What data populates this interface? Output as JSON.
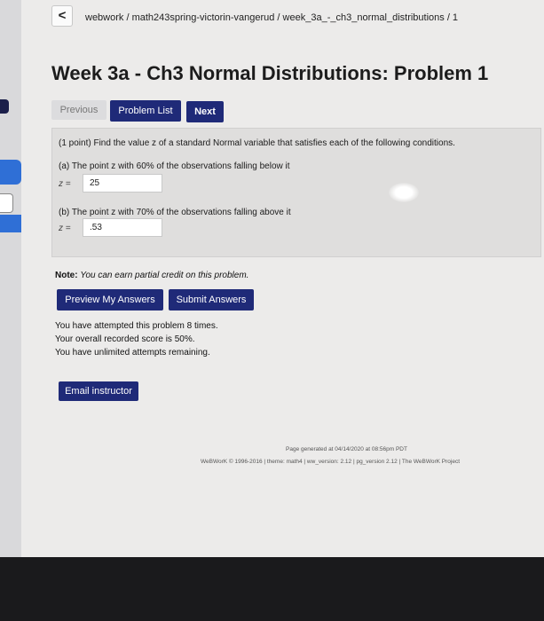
{
  "nav": {
    "back_glyph": "<",
    "breadcrumb": "webwork / math243spring-victorin-vangerud / week_3a_-_ch3_normal_distributions / 1"
  },
  "page": {
    "title": "Week 3a - Ch3 Normal Distributions: Problem 1"
  },
  "problem_nav": {
    "previous": "Previous",
    "problem_list": "Problem List",
    "next": "Next"
  },
  "problem": {
    "intro": "(1 point) Find the value z of a standard Normal variable that satisfies each of the following conditions.",
    "part_a": {
      "prompt": "(a) The point z with 60% of the observations falling below it",
      "label": "z =",
      "answer": "25"
    },
    "part_b": {
      "prompt": "(b) The point z with 70% of the observations falling above it",
      "label": "z =",
      "answer": ".53"
    }
  },
  "note": {
    "prefix": "Note:",
    "text": "You can earn partial credit on this problem."
  },
  "actions": {
    "preview": "Preview My Answers",
    "submit": "Submit Answers"
  },
  "status": {
    "attempts": "You have attempted this problem 8 times.",
    "score": "Your overall recorded score is 50%.",
    "remaining": "You have unlimited attempts remaining."
  },
  "email": {
    "label": "Email instructor"
  },
  "footer": {
    "generated": "Page generated at 04/14/2020 at 08:56pm PDT",
    "credits": "WeBWorK © 1996-2016 | theme: math4 | ww_version: 2.12 | pg_version 2.12 | The WeBWorK Project"
  }
}
